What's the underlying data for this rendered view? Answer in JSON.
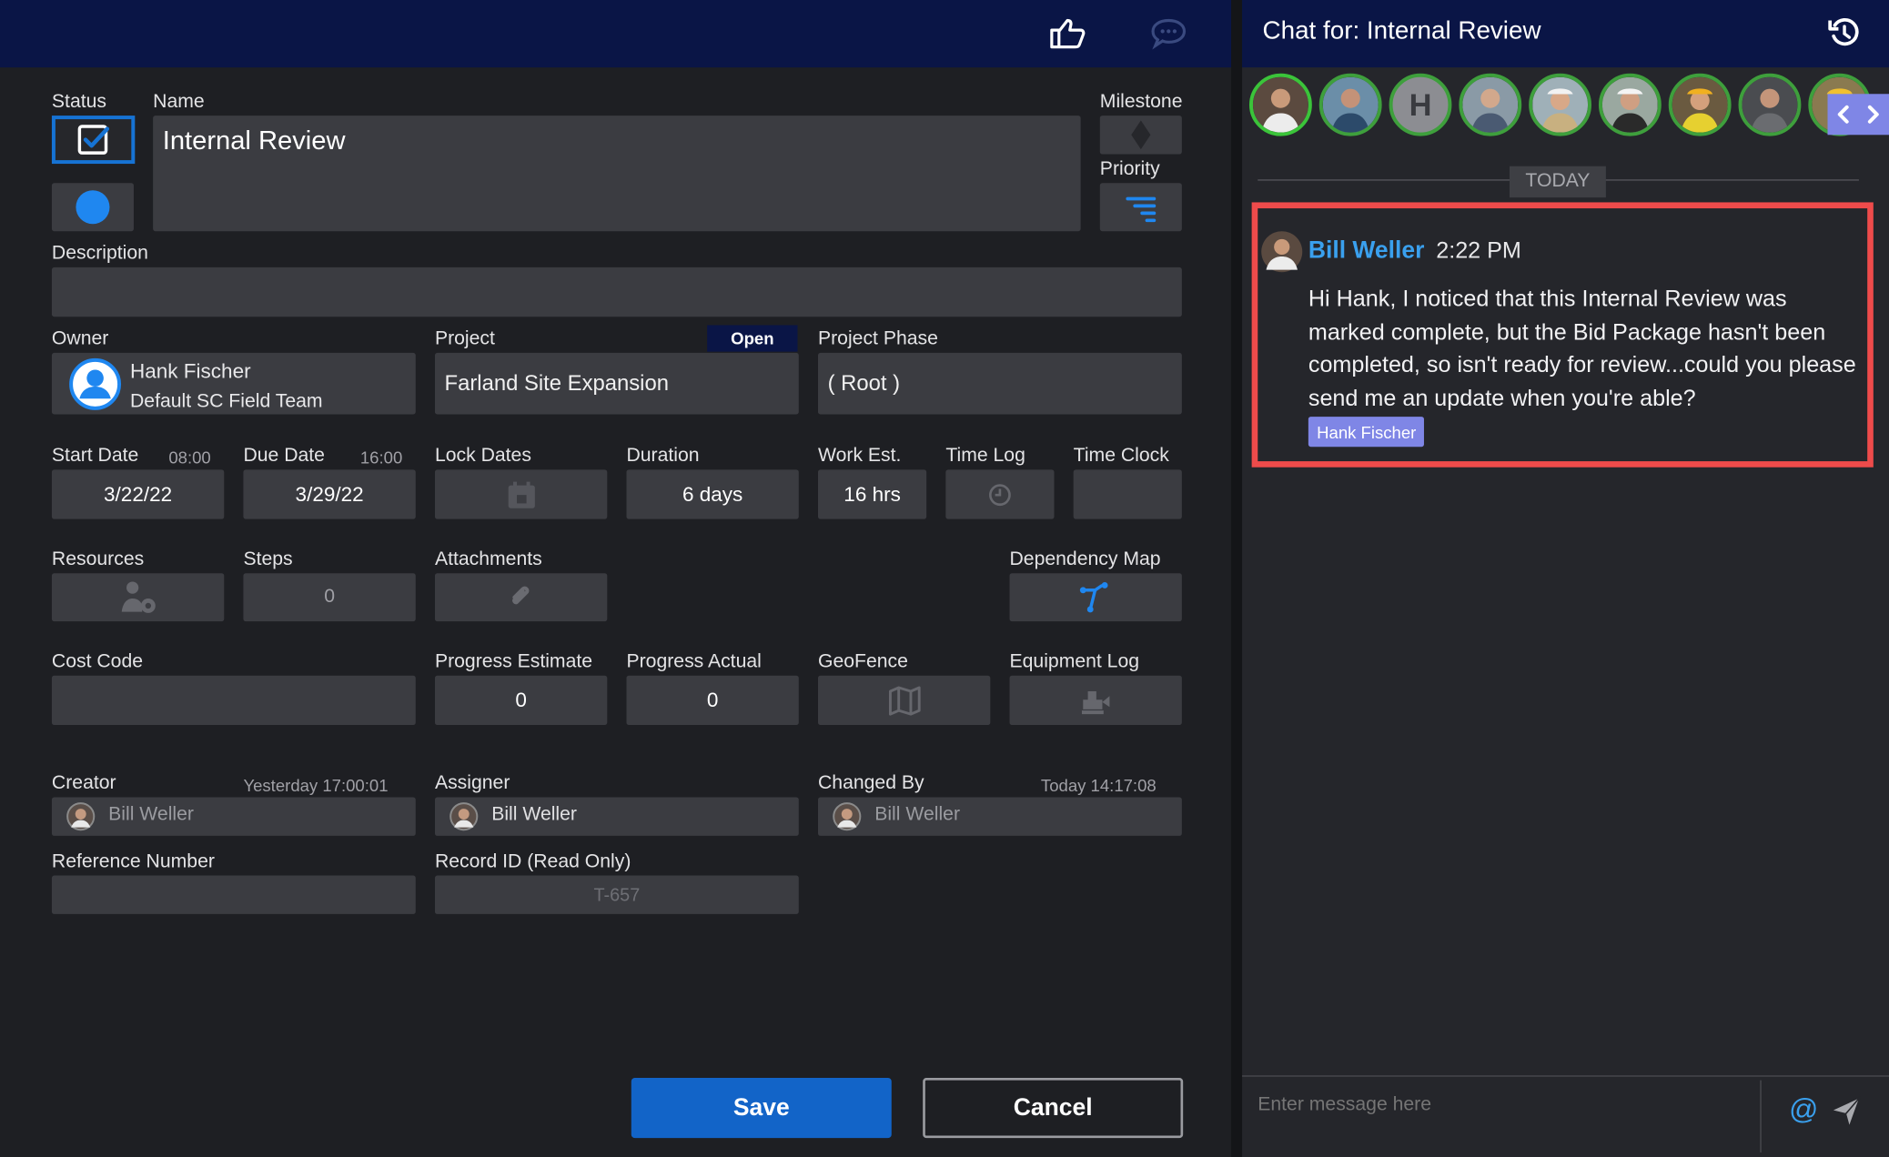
{
  "task": {
    "status_label": "Status",
    "name_label": "Name",
    "name_value": "Internal Review",
    "milestone_label": "Milestone",
    "priority_label": "Priority",
    "description_label": "Description",
    "description_value": "",
    "owner_label": "Owner",
    "owner_name": "Hank Fischer",
    "owner_team": "Default SC Field Team",
    "project_label": "Project",
    "project_status_badge": "Open",
    "project_value": "Farland Site Expansion",
    "project_phase_label": "Project Phase",
    "project_phase_value": "( Root )",
    "start_date_label": "Start Date",
    "start_time": "08:00",
    "start_date_value": "3/22/22",
    "due_date_label": "Due Date",
    "due_time": "16:00",
    "due_date_value": "3/29/22",
    "lock_dates_label": "Lock Dates",
    "duration_label": "Duration",
    "duration_value": "6 days",
    "work_est_label": "Work Est.",
    "work_est_value": "16 hrs",
    "time_log_label": "Time Log",
    "time_clock_label": "Time Clock",
    "resources_label": "Resources",
    "steps_label": "Steps",
    "steps_value": "0",
    "attachments_label": "Attachments",
    "dependency_map_label": "Dependency Map",
    "cost_code_label": "Cost Code",
    "progress_estimate_label": "Progress Estimate",
    "progress_estimate_value": "0",
    "progress_actual_label": "Progress Actual",
    "progress_actual_value": "0",
    "geofence_label": "GeoFence",
    "equipment_log_label": "Equipment Log",
    "creator_label": "Creator",
    "creator_time": "Yesterday  17:00:01",
    "creator_value": "Bill Weller",
    "assigner_label": "Assigner",
    "assigner_value": "Bill Weller",
    "changed_by_label": "Changed By",
    "changed_by_time": "Today  14:17:08",
    "changed_by_value": "Bill Weller",
    "reference_number_label": "Reference Number",
    "reference_number_value": "",
    "record_id_label": "Record ID (Read Only)",
    "record_id_value": "T-657",
    "save_label": "Save",
    "cancel_label": "Cancel"
  },
  "chat": {
    "title": "Chat for: Internal Review",
    "avatar_letter": "H",
    "day_separator": "TODAY",
    "message": {
      "author": "Bill Weller",
      "time": "2:22 PM",
      "text": "Hi Hank, I noticed that this Internal Review was marked complete, but the Bid Package hasn't been completed, so isn't ready for review...could you please send me an update when you're able?",
      "mention_tag": "Hank Fischer"
    },
    "input_placeholder": "Enter message here",
    "mention_symbol": "@"
  },
  "colors": {
    "header_bg": "#0a1546",
    "accent_blue": "#1673d4",
    "link_blue": "#3aa0ee",
    "highlight_red": "#ee4b4b",
    "mention_tag_bg": "#7f86e6",
    "avatar_ring_green": "#3e9f3c"
  },
  "icons": [
    "thumbs-up-icon",
    "chat-bubble-icon",
    "history-icon",
    "checkbox-checked-icon",
    "milestone-diamond-icon",
    "priority-filter-icon",
    "user-avatar-icon",
    "calendar-lock-icon",
    "clock-icon",
    "resources-icon",
    "paperclip-icon",
    "dependency-map-icon",
    "map-icon",
    "equipment-icon",
    "at-mention-icon",
    "send-icon",
    "chevron-left-icon",
    "chevron-right-icon"
  ]
}
